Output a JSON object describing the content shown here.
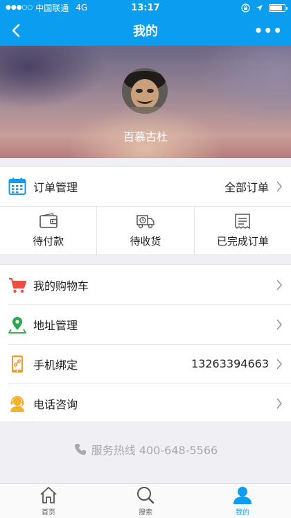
{
  "status_bar": {
    "signal": "●●●○○",
    "carrier": "中国联通",
    "network": "4G",
    "time": "13:17",
    "battery_level": 0.85
  },
  "nav": {
    "title": "我的",
    "back_icon": "chevron-left-icon",
    "more_label": "•••"
  },
  "profile": {
    "nickname": "百慕古杜"
  },
  "orders": {
    "title": "订单管理",
    "all_label": "全部订单",
    "tabs": [
      {
        "label": "待付款",
        "icon": "wallet-icon"
      },
      {
        "label": "待收货",
        "icon": "truck-icon"
      },
      {
        "label": "已完成订单",
        "icon": "receipt-icon"
      }
    ]
  },
  "menu": {
    "items": [
      {
        "label": "我的购物车",
        "icon": "cart-icon",
        "value": ""
      },
      {
        "label": "地址管理",
        "icon": "location-pin-icon",
        "value": ""
      },
      {
        "label": "手机绑定",
        "icon": "phone-link-icon",
        "value": "13263394663"
      },
      {
        "label": "电话咨询",
        "icon": "customer-service-icon",
        "value": ""
      }
    ]
  },
  "hotline": {
    "text": "服务热线 400-648-5566"
  },
  "tabbar": {
    "items": [
      {
        "label": "首页",
        "icon": "home-icon"
      },
      {
        "label": "搜索",
        "icon": "search-icon"
      },
      {
        "label": "我的",
        "icon": "user-icon"
      }
    ],
    "active_index": 2
  },
  "colors": {
    "primary": "#0a9df0",
    "cart": "#f04e3e",
    "location": "#2ba84a",
    "phone": "#f29b32",
    "service": "#f4b12e"
  }
}
